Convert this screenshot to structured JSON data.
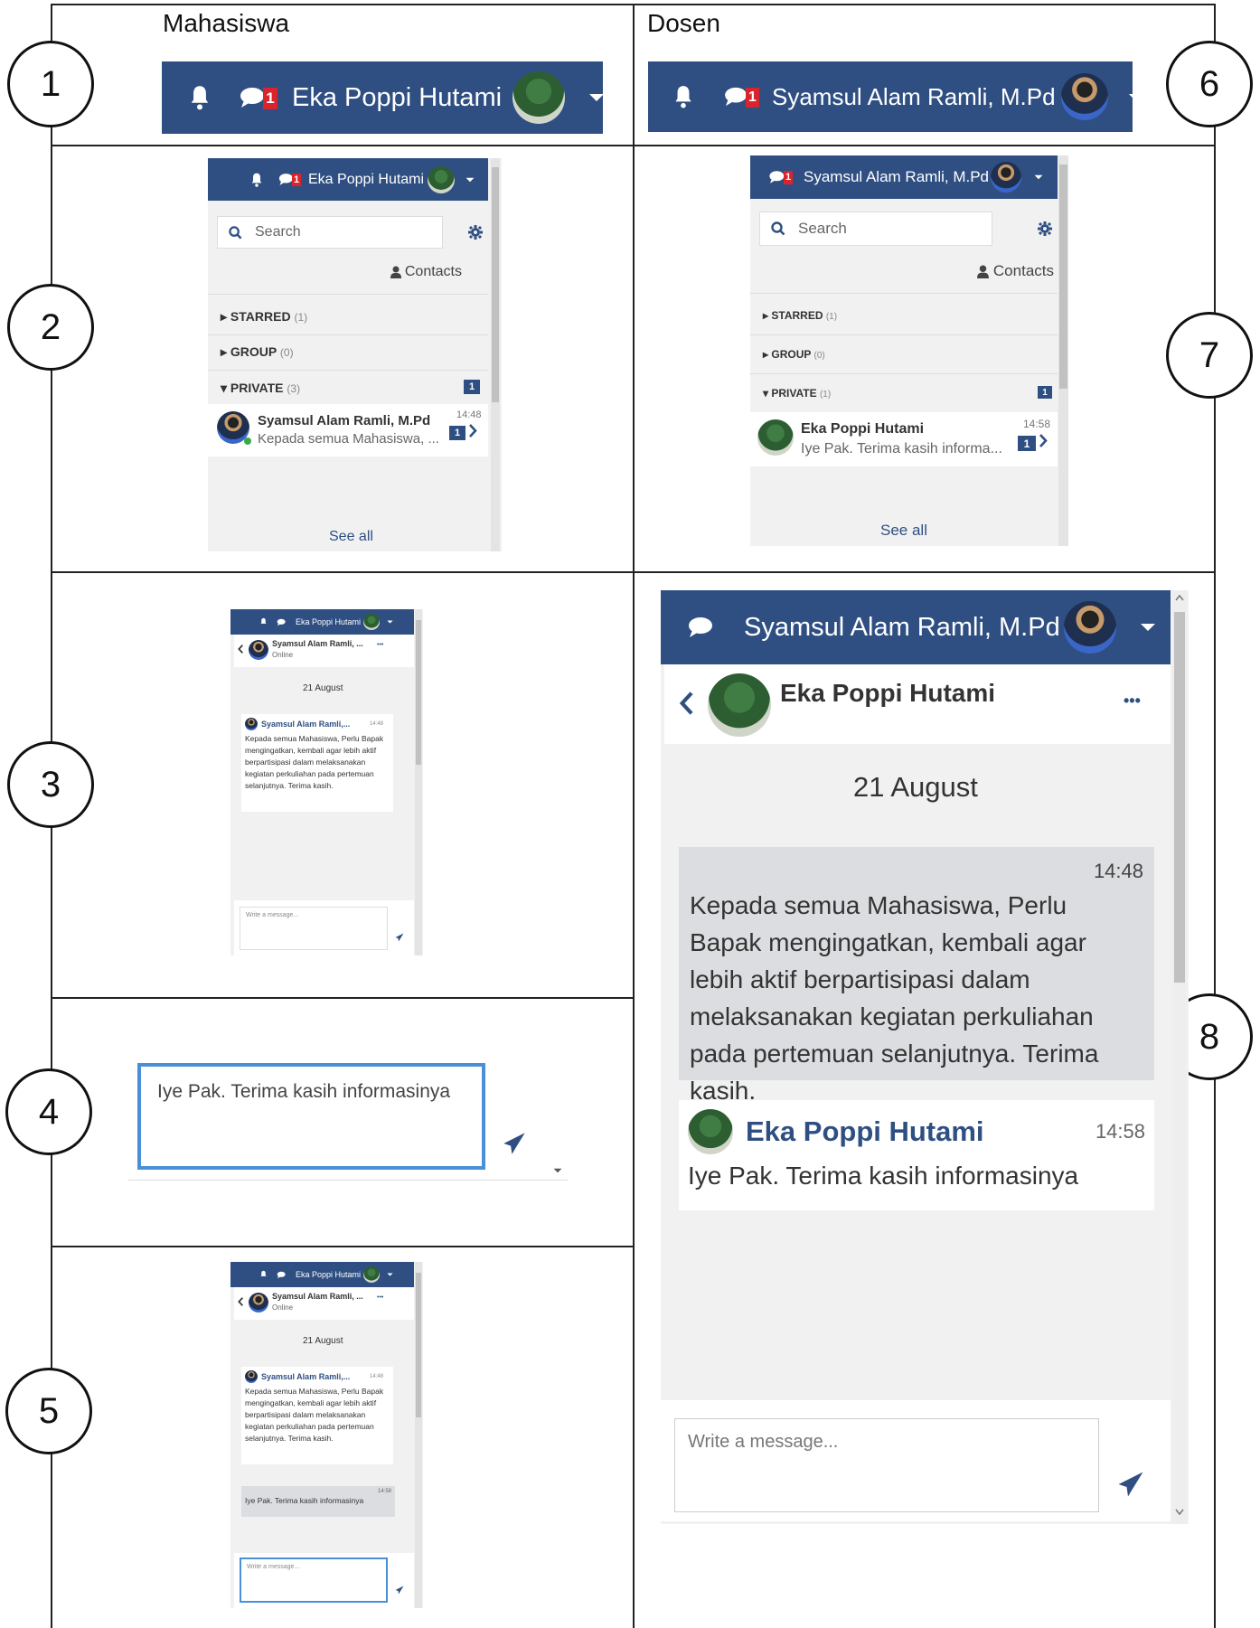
{
  "columns": {
    "left": "Mahasiswa",
    "right": "Dosen"
  },
  "steps": [
    "1",
    "2",
    "3",
    "4",
    "5",
    "6",
    "7",
    "8"
  ],
  "student": {
    "name": "Eka Poppi Hutami",
    "msg_count": "1"
  },
  "lecturer": {
    "name": "Syamsul Alam Ramli, M.Pd",
    "name_short": "Syamsul Alam Ramli, ...",
    "name_trunc": "Syamsul Alam Ramli,...",
    "msg_count": "1"
  },
  "drawer": {
    "search_placeholder": "Search",
    "contacts": "Contacts",
    "starred": "STARRED",
    "starred_count": "(1)",
    "group": "GROUP",
    "group_count": "(0)",
    "private": "PRIVATE",
    "private_count_student": "(3)",
    "private_count_lecturer": "(1)",
    "unread": "1",
    "see_all": "See all"
  },
  "conversations": {
    "student_view": {
      "name": "Syamsul Alam Ramli, M.Pd",
      "time": "14:48",
      "preview": "Kepada semua Mahasiswa, ..."
    },
    "lecturer_view": {
      "name": "Eka Poppi Hutami",
      "time": "14:58",
      "preview": "Iye Pak. Terima kasih informa..."
    }
  },
  "chat": {
    "status": "Online",
    "date": "21 August",
    "msg1_time": "14:48",
    "msg1_text": "Kepada semua Mahasiswa, Perlu Bapak mengingatkan, kembali agar lebih aktif berpartisipasi dalam melaksanakan kegiatan perkuliahan pada pertemuan selanjutnya. Terima kasih.",
    "msg2_time": "14:58",
    "msg2_text": "Iye Pak. Terima kasih informasinya",
    "input_placeholder": "Write a message...",
    "typed": "Iye Pak. Terima kasih informasinya",
    "more": "•••"
  },
  "colors": {
    "navy": "#2f4f82",
    "red": "#d9232d",
    "blue_border": "#4a90d9",
    "panel": "#f1f1f1"
  }
}
